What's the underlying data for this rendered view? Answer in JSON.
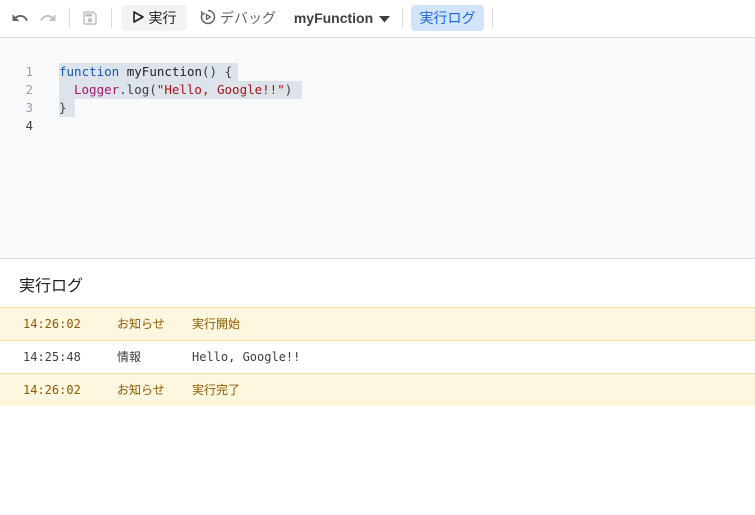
{
  "toolbar": {
    "run_label": "実行",
    "debug_label": "デバッグ",
    "function_name": "myFunction",
    "log_label": "実行ログ"
  },
  "editor": {
    "line_numbers": [
      "1",
      "2",
      "3",
      "4"
    ],
    "line1": {
      "kw": "function",
      "name": " myFunction",
      "rest": "() {"
    },
    "line2": {
      "obj": "Logger",
      "method": ".log(",
      "str": "\"Hello, Google!!\"",
      "end": ")"
    },
    "line3": {
      "text": "}"
    }
  },
  "log": {
    "title": "実行ログ",
    "rows": [
      {
        "time": "14:26:02",
        "severity": "お知らせ",
        "message": "実行開始"
      },
      {
        "time": "14:25:48",
        "severity": "情報",
        "message": "Hello, Google!!"
      },
      {
        "time": "14:26:02",
        "severity": "お知らせ",
        "message": "実行完了"
      }
    ]
  },
  "colors": {
    "accent": "#1967d2",
    "notice_bg": "#fef7e0",
    "notice_text": "#8a5a00",
    "editor_bg": "#f8f9fa"
  }
}
